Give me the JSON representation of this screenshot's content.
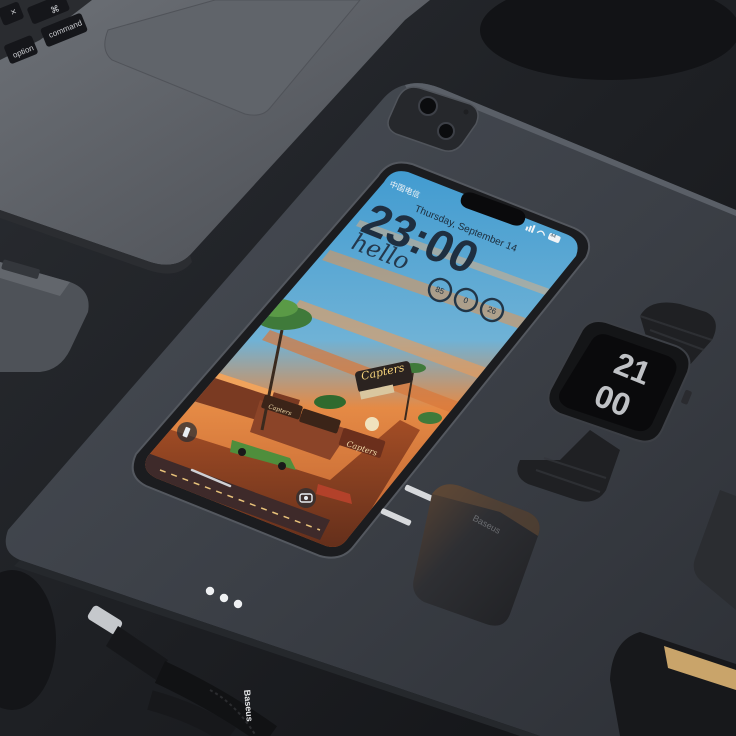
{
  "scene": {
    "colors": {
      "desk": "#1c1e22",
      "tablet": "#3a3e45",
      "laptop": "#575b61",
      "phone_frame": "#1b1c1f",
      "sky": "#5aa3cf",
      "sunset_orange": "#d9783a",
      "watch_band": "#1f2023",
      "charger": "#2b2c30"
    }
  },
  "laptop": {
    "keys": [
      "option",
      "command",
      "⌘",
      "×"
    ]
  },
  "phone": {
    "carrier": "中国电信",
    "status_icons": [
      "signal-icon",
      "wifi-icon",
      "battery-icon"
    ],
    "battery": "44",
    "date": "Thursday, September 14",
    "time": "23:00",
    "greeting": "hello",
    "widgets": [
      "85",
      "0",
      "26"
    ],
    "signs": {
      "main": "Capters",
      "sub": "Capters",
      "street": "Capters"
    }
  },
  "watch": {
    "time_hours": "21",
    "time_minutes": "00"
  },
  "charger": {
    "brand": "Baseus"
  },
  "cable": {
    "brand": "Baseus"
  },
  "tablet": {
    "indicator": "•••"
  }
}
